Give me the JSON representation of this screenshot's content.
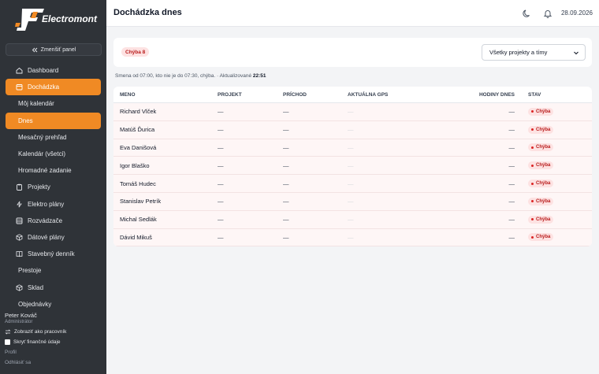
{
  "brand": {
    "name": "Electromont"
  },
  "sidebar": {
    "collapse_label": "Zmenšiť panel",
    "items": [
      {
        "label": "Dashboard",
        "icon": "home-icon"
      },
      {
        "label": "Dochádzka",
        "icon": "calendar-icon"
      },
      {
        "label": "Môj kalendár",
        "icon": ""
      },
      {
        "label": "Dnes",
        "icon": ""
      },
      {
        "label": "Mesačný prehľad",
        "icon": ""
      },
      {
        "label": "Kalendár (všetci)",
        "icon": ""
      },
      {
        "label": "Hromadné zadanie",
        "icon": ""
      },
      {
        "label": "Projekty",
        "icon": "clipboard-icon"
      },
      {
        "label": "Elektro plány",
        "icon": "bolt-icon"
      },
      {
        "label": "Rozvádzače",
        "icon": "panel-icon"
      },
      {
        "label": "Dátové plány",
        "icon": "box-icon"
      },
      {
        "label": "Stavebný denník",
        "icon": "book-icon"
      },
      {
        "label": "Prestoje",
        "icon": ""
      },
      {
        "label": "Sklad",
        "icon": "package-icon"
      },
      {
        "label": "Objednávky",
        "icon": ""
      }
    ],
    "user": {
      "name": "Peter Kováč",
      "role": "Administrátor",
      "switch_label": "Zobraziť ako pracovník",
      "hide_fin_label": "Skryť finančné údaje",
      "profile_label": "Profil",
      "logout_label": "Odhlásiť sa"
    }
  },
  "header": {
    "title": "Dochádzka dnes",
    "date": "28.09.2026"
  },
  "filters": {
    "error_badge": "Chýba 8",
    "project_select": "Všetky projekty a tímy"
  },
  "info": {
    "text": "Smena od 07:00, kto nie je do 07:30, chýba. · Aktualizované",
    "time": "22:51"
  },
  "table": {
    "headers": {
      "name": "MENO",
      "project": "PROJEKT",
      "arrival": "PRÍCHOD",
      "gps": "AKTUÁLNA GPS",
      "hours": "HODINY DNES",
      "state": "STAV"
    },
    "rows": [
      {
        "name": "Richard Vlček",
        "project": "—",
        "arrival": "—",
        "gps": "—",
        "hours": "—",
        "state": "Chýba"
      },
      {
        "name": "Matúš Ďurica",
        "project": "—",
        "arrival": "—",
        "gps": "—",
        "hours": "—",
        "state": "Chýba"
      },
      {
        "name": "Eva Danišová",
        "project": "—",
        "arrival": "—",
        "gps": "—",
        "hours": "—",
        "state": "Chýba"
      },
      {
        "name": "Igor Blaško",
        "project": "—",
        "arrival": "—",
        "gps": "—",
        "hours": "—",
        "state": "Chýba"
      },
      {
        "name": "Tomáš Hudec",
        "project": "—",
        "arrival": "—",
        "gps": "—",
        "hours": "—",
        "state": "Chýba"
      },
      {
        "name": "Stanislav Petrík",
        "project": "—",
        "arrival": "—",
        "gps": "—",
        "hours": "—",
        "state": "Chýba"
      },
      {
        "name": "Michal Sedlák",
        "project": "—",
        "arrival": "—",
        "gps": "—",
        "hours": "—",
        "state": "Chýba"
      },
      {
        "name": "Dávid Mikuš",
        "project": "—",
        "arrival": "—",
        "gps": "—",
        "hours": "—",
        "state": "Chýba"
      }
    ]
  },
  "colors": {
    "accent": "#f08a24",
    "sidebar_bg": "#2f3338",
    "error": "#b91c1c",
    "row_bg": "#fef6f6"
  }
}
